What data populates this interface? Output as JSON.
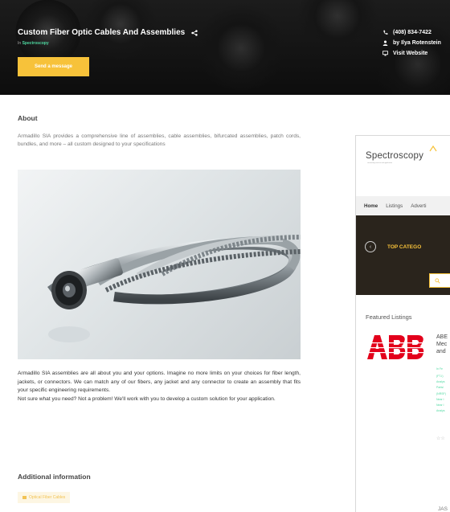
{
  "hero": {
    "title": "Custom Fiber Optic Cables And Assemblies",
    "in_prefix": "In",
    "category": "Spectroscopy",
    "send_button": "Send a message",
    "phone": "(408) 834-7422",
    "author": "by Ilya Rotenstein",
    "website": "Visit Website"
  },
  "about": {
    "heading": "About",
    "text": "Armadillo SIA provides a comprehensive line of assemblies, cable assemblies, bifurcated assemblies, patch cords, bundles, and more – all custom designed to your specifications"
  },
  "body": {
    "paragraph1": "Armadillo SIA assemblies are all about you and your options. Imagine no more limits on your choices for fiber length, jackets, or connectors. We can match any of our fibers, any jacket and any connector to create an assembly that fits your specific engineering requirements.",
    "paragraph2": "Not sure what you need? Not a problem! We'll work with you to develop a custom solution for your application."
  },
  "additional": {
    "heading": "Additional information",
    "tag": "Optical Fiber Cables"
  },
  "widget": {
    "logo": "Spectroscopy",
    "logo_tagline": "connecting science and application",
    "nav": [
      "Home",
      "Listings",
      "Adverti"
    ],
    "top_categories": "TOP CATEGO",
    "featured_heading": "Featured Listings",
    "listing_title_lines": [
      "ABE",
      "Mec",
      "and"
    ],
    "listing_in": "In Fe",
    "listing_links": [
      "(FT-I)",
      "Analys",
      "Parts/",
      "(NRSF)",
      "Near I",
      "Near I",
      "Analys"
    ],
    "stars": "☆☆",
    "bottom_text": "JAS"
  },
  "colors": {
    "accent": "#f7c23a",
    "category_green": "#4dd8a0",
    "abb_red": "#e3001b",
    "hero_dark": "#111111"
  },
  "icons": [
    "share-icon",
    "phone-icon",
    "user-icon",
    "monitor-icon",
    "chevron-left-icon",
    "search-icon",
    "folder-icon"
  ]
}
